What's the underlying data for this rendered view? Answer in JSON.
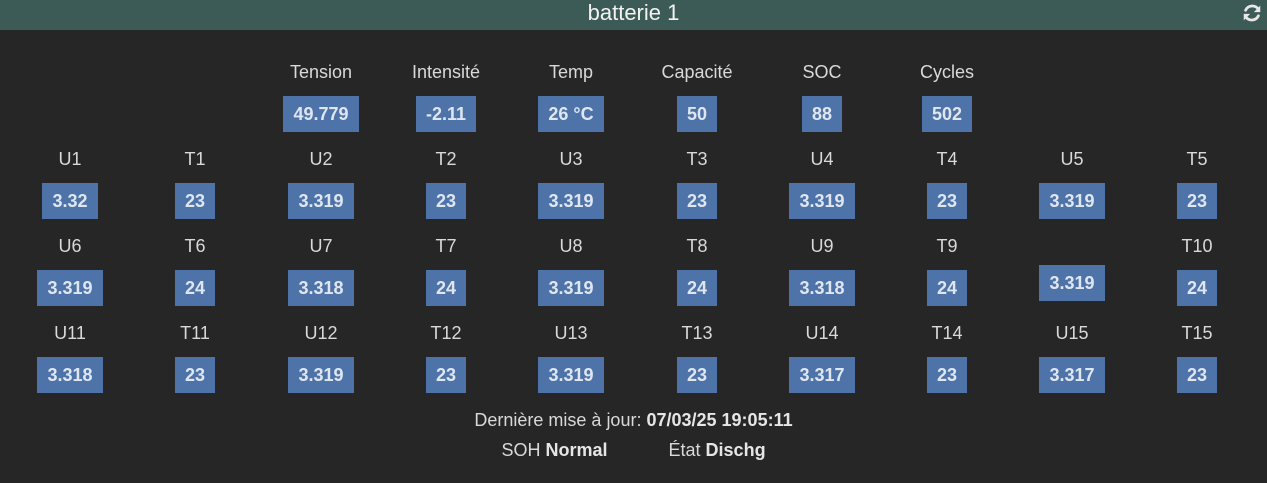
{
  "header": {
    "title": "batterie 1",
    "refresh_icon": "refresh-icon"
  },
  "summary": [
    {
      "label": "Tension",
      "value": "49.779"
    },
    {
      "label": "Intensité",
      "value": "-2.11"
    },
    {
      "label": "Temp",
      "value": "26 °C"
    },
    {
      "label": "Capacité",
      "value": "50"
    },
    {
      "label": "SOC",
      "value": "88"
    },
    {
      "label": "Cycles",
      "value": "502"
    }
  ],
  "cells": [
    [
      {
        "label": "U1",
        "value": "3.32"
      },
      {
        "label": "T1",
        "value": "23"
      },
      {
        "label": "U2",
        "value": "3.319"
      },
      {
        "label": "T2",
        "value": "23"
      },
      {
        "label": "U3",
        "value": "3.319"
      },
      {
        "label": "T3",
        "value": "23"
      },
      {
        "label": "U4",
        "value": "3.319"
      },
      {
        "label": "T4",
        "value": "23"
      },
      {
        "label": "U5",
        "value": "3.319"
      },
      {
        "label": "T5",
        "value": "23"
      }
    ],
    [
      {
        "label": "U6",
        "value": "3.319"
      },
      {
        "label": "T6",
        "value": "24"
      },
      {
        "label": "U7",
        "value": "3.318"
      },
      {
        "label": "T7",
        "value": "24"
      },
      {
        "label": "U8",
        "value": "3.319"
      },
      {
        "label": "T8",
        "value": "24"
      },
      {
        "label": "U9",
        "value": "3.318"
      },
      {
        "label": "T9",
        "value": "24"
      },
      {
        "label": "",
        "value": "3.319"
      },
      {
        "label": "T10",
        "value": "24"
      }
    ],
    [
      {
        "label": "U11",
        "value": "3.318"
      },
      {
        "label": "T11",
        "value": "23"
      },
      {
        "label": "U12",
        "value": "3.319"
      },
      {
        "label": "T12",
        "value": "23"
      },
      {
        "label": "U13",
        "value": "3.319"
      },
      {
        "label": "T13",
        "value": "23"
      },
      {
        "label": "U14",
        "value": "3.317"
      },
      {
        "label": "T14",
        "value": "23"
      },
      {
        "label": "U15",
        "value": "3.317"
      },
      {
        "label": "T15",
        "value": "23"
      }
    ]
  ],
  "footer": {
    "last_update_label": "Dernière mise à jour:",
    "last_update_value": "07/03/25 19:05:11",
    "soh_label": "SOH",
    "soh_value": "Normal",
    "state_label": "État",
    "state_value": "Dischg"
  },
  "colors": {
    "background": "#262626",
    "header": "#3c5b56",
    "value_box": "#4e73a8"
  }
}
